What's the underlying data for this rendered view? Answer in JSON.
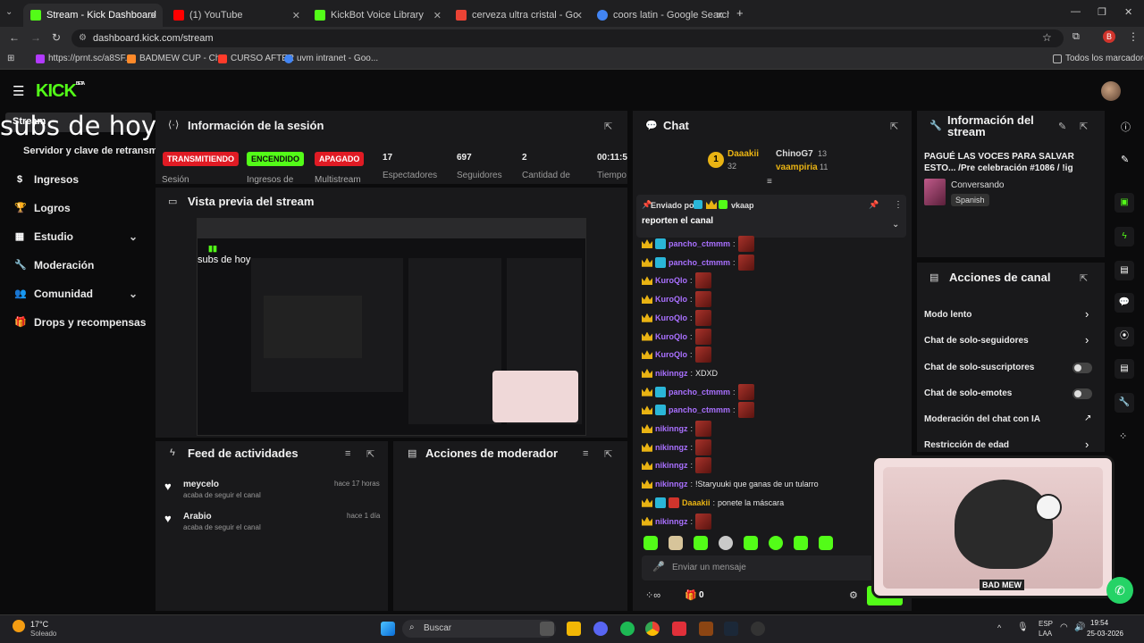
{
  "browser": {
    "tabs": [
      {
        "label": "Stream - Kick Dashboard",
        "color": "#53fc18"
      },
      {
        "label": "(1) YouTube",
        "color": "#ff0000"
      },
      {
        "label": "KickBot Voice Library",
        "color": "#53fc18"
      },
      {
        "label": "cerveza ultra cristal - Google Sh",
        "color": "#ea4335"
      },
      {
        "label": "coors latin - Google Search",
        "color": "#4285f4"
      }
    ],
    "url": "dashboard.kick.com/stream",
    "bookmarks": [
      "https://prnt.sc/a8SF...",
      "BADMEW CUP - Ch...",
      "CURSO AFTER",
      "uvm intranet - Goo..."
    ],
    "all_bookmarks": "Todos los marcadores"
  },
  "kick": {
    "logo": "KICK",
    "beta": "BETA"
  },
  "overlay_text": "subs de hoy",
  "sidebar": {
    "stream": "Stream",
    "server_key": "Servidor y clave de retransm",
    "items": [
      {
        "label": "Ingresos",
        "icon": "dollar-icon",
        "glyph": "$"
      },
      {
        "label": "Logros",
        "icon": "trophy-icon",
        "glyph": "🏆"
      },
      {
        "label": "Estudio",
        "icon": "studio-icon",
        "glyph": "▦"
      },
      {
        "label": "Moderación",
        "icon": "wrench-icon",
        "glyph": "🔧"
      },
      {
        "label": "Comunidad",
        "icon": "community-icon",
        "glyph": "👥"
      },
      {
        "label": "Drops y recompensas",
        "icon": "gift-icon",
        "glyph": "🎁"
      }
    ]
  },
  "session": {
    "title": "Información de la sesión",
    "badges": [
      {
        "label": "TRANSMITIENDO",
        "sub": "Sesión",
        "color": "#e01b24"
      },
      {
        "label": "ENCENDIDO",
        "sub": "Ingresos de",
        "color": "#53fc18"
      },
      {
        "label": "APAGADO",
        "sub": "Multistream",
        "color": "#e01b24"
      }
    ],
    "stats": [
      {
        "value": "17",
        "label": "Espectadores"
      },
      {
        "value": "697",
        "label": "Seguidores"
      },
      {
        "value": "2",
        "label": "Cantidad de"
      },
      {
        "value": "00:11:5",
        "label": "Tiempo"
      }
    ]
  },
  "preview": {
    "title": "Vista previa del stream"
  },
  "feed": {
    "title": "Feed de actividades",
    "items": [
      {
        "user": "meycelo",
        "action": "acaba de seguir el canal",
        "time": "hace 17 horas"
      },
      {
        "user": "Arabio",
        "action": "acaba de seguir el canal",
        "time": "hace 1 día"
      }
    ]
  },
  "mod_actions": {
    "title": "Acciones de moderador"
  },
  "chat": {
    "title": "Chat",
    "leaderboard": [
      {
        "rank": "1",
        "user": "Daaakii",
        "count": "32"
      },
      {
        "user": "ChinoG7",
        "count": "13"
      },
      {
        "user": "vaampiria",
        "count": "11"
      }
    ],
    "pinned_by_label": "Enviado por",
    "pinned_user": "vkaap",
    "pinned_message": "reporten el canal",
    "messages": [
      {
        "user": "pancho_ctmmm",
        "text": "",
        "color": "#a970ff",
        "emote": true,
        "badges": 2
      },
      {
        "user": "pancho_ctmmm",
        "text": "",
        "color": "#a970ff",
        "emote": true,
        "badges": 2
      },
      {
        "user": "KuroQlo",
        "text": "",
        "color": "#a970ff",
        "emote": true,
        "badges": 1
      },
      {
        "user": "KuroQlo",
        "text": "",
        "color": "#a970ff",
        "emote": true,
        "badges": 1
      },
      {
        "user": "KuroQlo",
        "text": "",
        "color": "#a970ff",
        "emote": true,
        "badges": 1
      },
      {
        "user": "KuroQlo",
        "text": "",
        "color": "#a970ff",
        "emote": true,
        "badges": 1
      },
      {
        "user": "KuroQlo",
        "text": "",
        "color": "#a970ff",
        "emote": true,
        "badges": 1
      },
      {
        "user": "nikinngz",
        "text": "XDXD",
        "color": "#a970ff",
        "emote": false,
        "badges": 1
      },
      {
        "user": "pancho_ctmmm",
        "text": "",
        "color": "#a970ff",
        "emote": true,
        "badges": 2
      },
      {
        "user": "pancho_ctmmm",
        "text": "",
        "color": "#a970ff",
        "emote": true,
        "badges": 2
      },
      {
        "user": "nikinngz",
        "text": "",
        "color": "#a970ff",
        "emote": true,
        "badges": 1
      },
      {
        "user": "nikinngz",
        "text": "",
        "color": "#a970ff",
        "emote": true,
        "badges": 1
      },
      {
        "user": "nikinngz",
        "text": "",
        "color": "#a970ff",
        "emote": true,
        "badges": 1
      },
      {
        "user": "nikinngz",
        "text": "!Staryuuki que ganas de un tularro",
        "color": "#a970ff",
        "emote": false,
        "badges": 1
      },
      {
        "user": "Daaakii",
        "text": "ponete la máscara",
        "color": "#e9b313",
        "emote": false,
        "badges": 3
      },
      {
        "user": "nikinngz",
        "text": "",
        "color": "#a970ff",
        "emote": true,
        "badges": 1
      }
    ],
    "input_placeholder": "Enviar un mensaje",
    "points": "0",
    "send_label": "Chat"
  },
  "stream_info": {
    "title": "Información del stream",
    "stream_title": "PAGUÉ LAS VOCES PARA SALVAR ESTO... /Pre celebración #1086 / !ig",
    "category": "Conversando",
    "language": "Spanish"
  },
  "channel_actions": {
    "title": "Acciones de canal",
    "items": [
      {
        "label": "Modo lento",
        "control": "chevron"
      },
      {
        "label": "Chat de solo-seguidores",
        "control": "chevron"
      },
      {
        "label": "Chat de solo-suscriptores",
        "control": "toggle"
      },
      {
        "label": "Chat de solo-emotes",
        "control": "toggle"
      },
      {
        "label": "Moderación del chat con IA",
        "control": "link"
      },
      {
        "label": "Restricción de edad",
        "control": "chevron"
      }
    ]
  },
  "taskbar": {
    "weather_temp": "17°C",
    "weather_desc": "Soleado",
    "search": "Buscar",
    "lang1": "ESP",
    "lang2": "LAA",
    "time": "19:54",
    "date": "25-03-2026"
  },
  "webcam_label": "BAD MEW"
}
